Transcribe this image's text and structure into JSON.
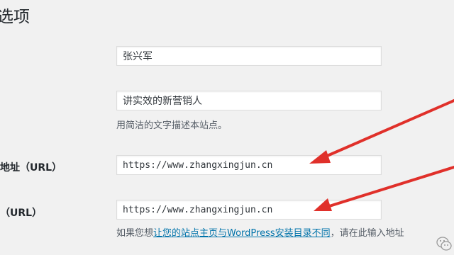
{
  "page": {
    "title": "选项"
  },
  "fields": {
    "blog_name": {
      "value": "张兴军"
    },
    "tagline": {
      "value": "讲实效的新营销人",
      "description": "用简洁的文字描述本站点。"
    },
    "wp_address": {
      "label": "地址（URL）",
      "value": "https://www.zhangxingjun.cn"
    },
    "site_address": {
      "label": "（URL）",
      "value": "https://www.zhangxingjun.cn",
      "description_prefix": "如果您想",
      "description_link": "让您的站点主页与WordPress安装目录不同",
      "description_suffix": "，请在此输入地址"
    }
  },
  "colors": {
    "arrow": "#e0302a",
    "link": "#0073aa",
    "background": "#f1f1f1"
  },
  "icons": {
    "watermark": "wechat-watermark-icon"
  }
}
